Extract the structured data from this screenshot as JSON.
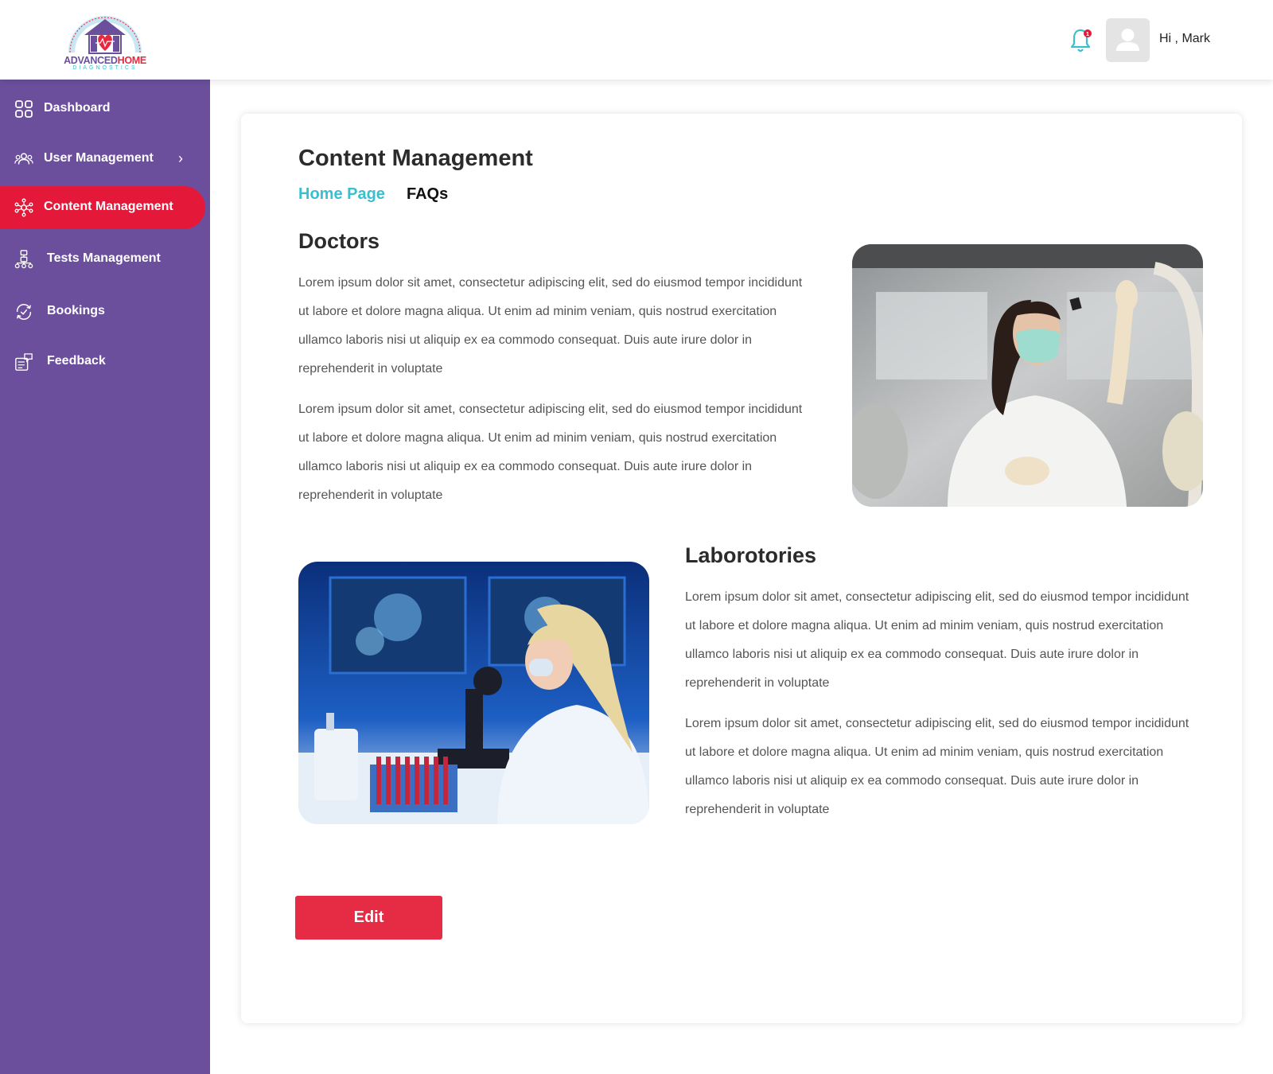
{
  "brand": {
    "logo_text_left": "ADVANCED",
    "logo_text_right": "HOME",
    "logo_subtitle": "DIAGNOSTICS",
    "logo_arc_text": "Brings the lab services you need to the location you want"
  },
  "header": {
    "greeting": "Hi , Mark",
    "notification_count": "1"
  },
  "sidebar": {
    "items": [
      {
        "label": "Dashboard",
        "icon": "grid-icon"
      },
      {
        "label": "User Management",
        "icon": "users-icon"
      },
      {
        "label": "Content Management",
        "icon": "network-icon"
      },
      {
        "label": "Tests Management",
        "icon": "hierarchy-icon"
      },
      {
        "label": "Bookings",
        "icon": "refresh-check-icon"
      },
      {
        "label": "Feedback",
        "icon": "feedback-icon"
      }
    ],
    "active_index": 2
  },
  "main": {
    "title": "Content Management",
    "tabs": [
      {
        "label": "Home Page",
        "active": true
      },
      {
        "label": "FAQs",
        "active": false
      }
    ],
    "sections": [
      {
        "title": "Doctors",
        "paragraphs": [
          "Lorem ipsum dolor sit amet, consectetur adipiscing elit, sed do eiusmod tempor incididunt ut labore et dolore magna aliqua. Ut enim ad minim veniam, quis nostrud exercitation ullamco laboris nisi ut aliquip ex ea commodo consequat. Duis aute irure dolor in reprehenderit in voluptate",
          "Lorem ipsum dolor sit amet, consectetur adipiscing elit, sed do eiusmod tempor incididunt ut labore et dolore magna aliqua. Ut enim ad minim veniam, quis nostrud exercitation ullamco laboris nisi ut aliquip ex ea commodo consequat. Duis aute irure dolor in reprehenderit in voluptate"
        ]
      },
      {
        "title": "Laborotories",
        "paragraphs": [
          "Lorem ipsum dolor sit amet, consectetur adipiscing elit, sed do eiusmod tempor incididunt ut labore et dolore magna aliqua. Ut enim ad minim veniam, quis nostrud exercitation ullamco laboris nisi ut aliquip ex ea commodo consequat. Duis aute irure dolor in reprehenderit in voluptate",
          "Lorem ipsum dolor sit amet, consectetur adipiscing elit, sed do eiusmod tempor incididunt ut labore et dolore magna aliqua. Ut enim ad minim veniam, quis nostrud exercitation ullamco laboris nisi ut aliquip ex ea commodo consequat. Duis aute irure dolor in reprehenderit in voluptate"
        ]
      }
    ],
    "edit_label": "Edit"
  },
  "colors": {
    "sidebar_bg": "#6b4f9c",
    "active_item": "#e4193a",
    "accent_teal": "#3bbfcf",
    "edit_button": "#e52c44"
  }
}
